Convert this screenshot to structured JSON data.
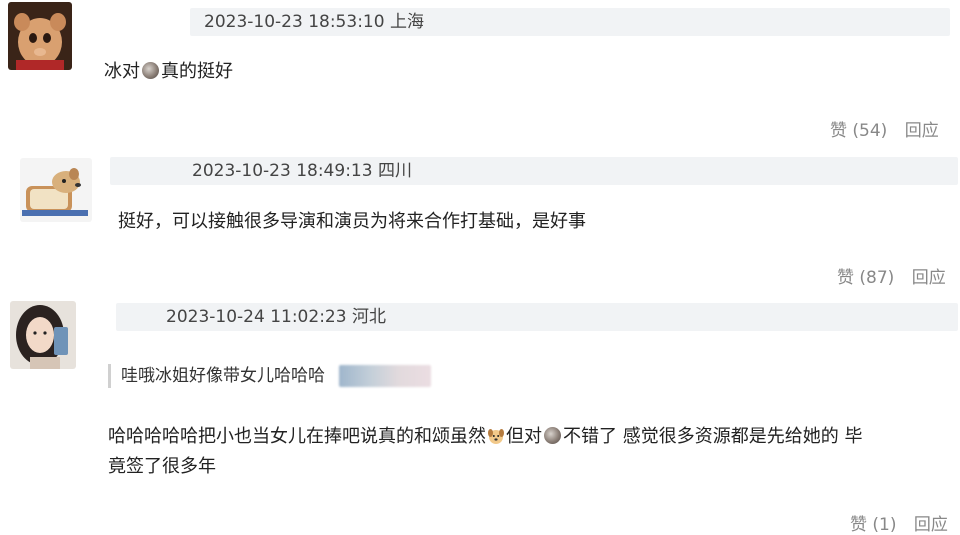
{
  "comments": [
    {
      "meta": "2023-10-23 18:53:10 上海",
      "text_before": "冰对",
      "text_after": "真的挺好",
      "like_label": "赞 (54)",
      "reply_label": "回应"
    },
    {
      "meta": "2023-10-23 18:49:13 四川",
      "text": "挺好，可以接触很多导演和演员为将来合作打基础，是好事",
      "like_label": "赞 (87)",
      "reply_label": "回应"
    },
    {
      "meta": "2023-10-24 11:02:23 河北",
      "quote": "哇哦冰姐好像带女儿哈哈哈",
      "text_part1": "哈哈哈哈哈把小也当女儿在捧吧说真的和颂虽然",
      "text_part2": "但对",
      "text_part3": "不错了 感觉很多资源都是先给她的 毕",
      "text_line2": "竟签了很多年",
      "like_label": "赞 (1)",
      "reply_label": "回应"
    }
  ],
  "colors": {
    "meta_bg": "#f1f3f5",
    "action_text": "#888888",
    "quote_border": "#d0d0d0"
  },
  "icons": [
    "doll-avatar",
    "dog-bread-avatar",
    "girl-selfie-avatar",
    "gray-dot-emoji",
    "dog-face-emoji"
  ]
}
